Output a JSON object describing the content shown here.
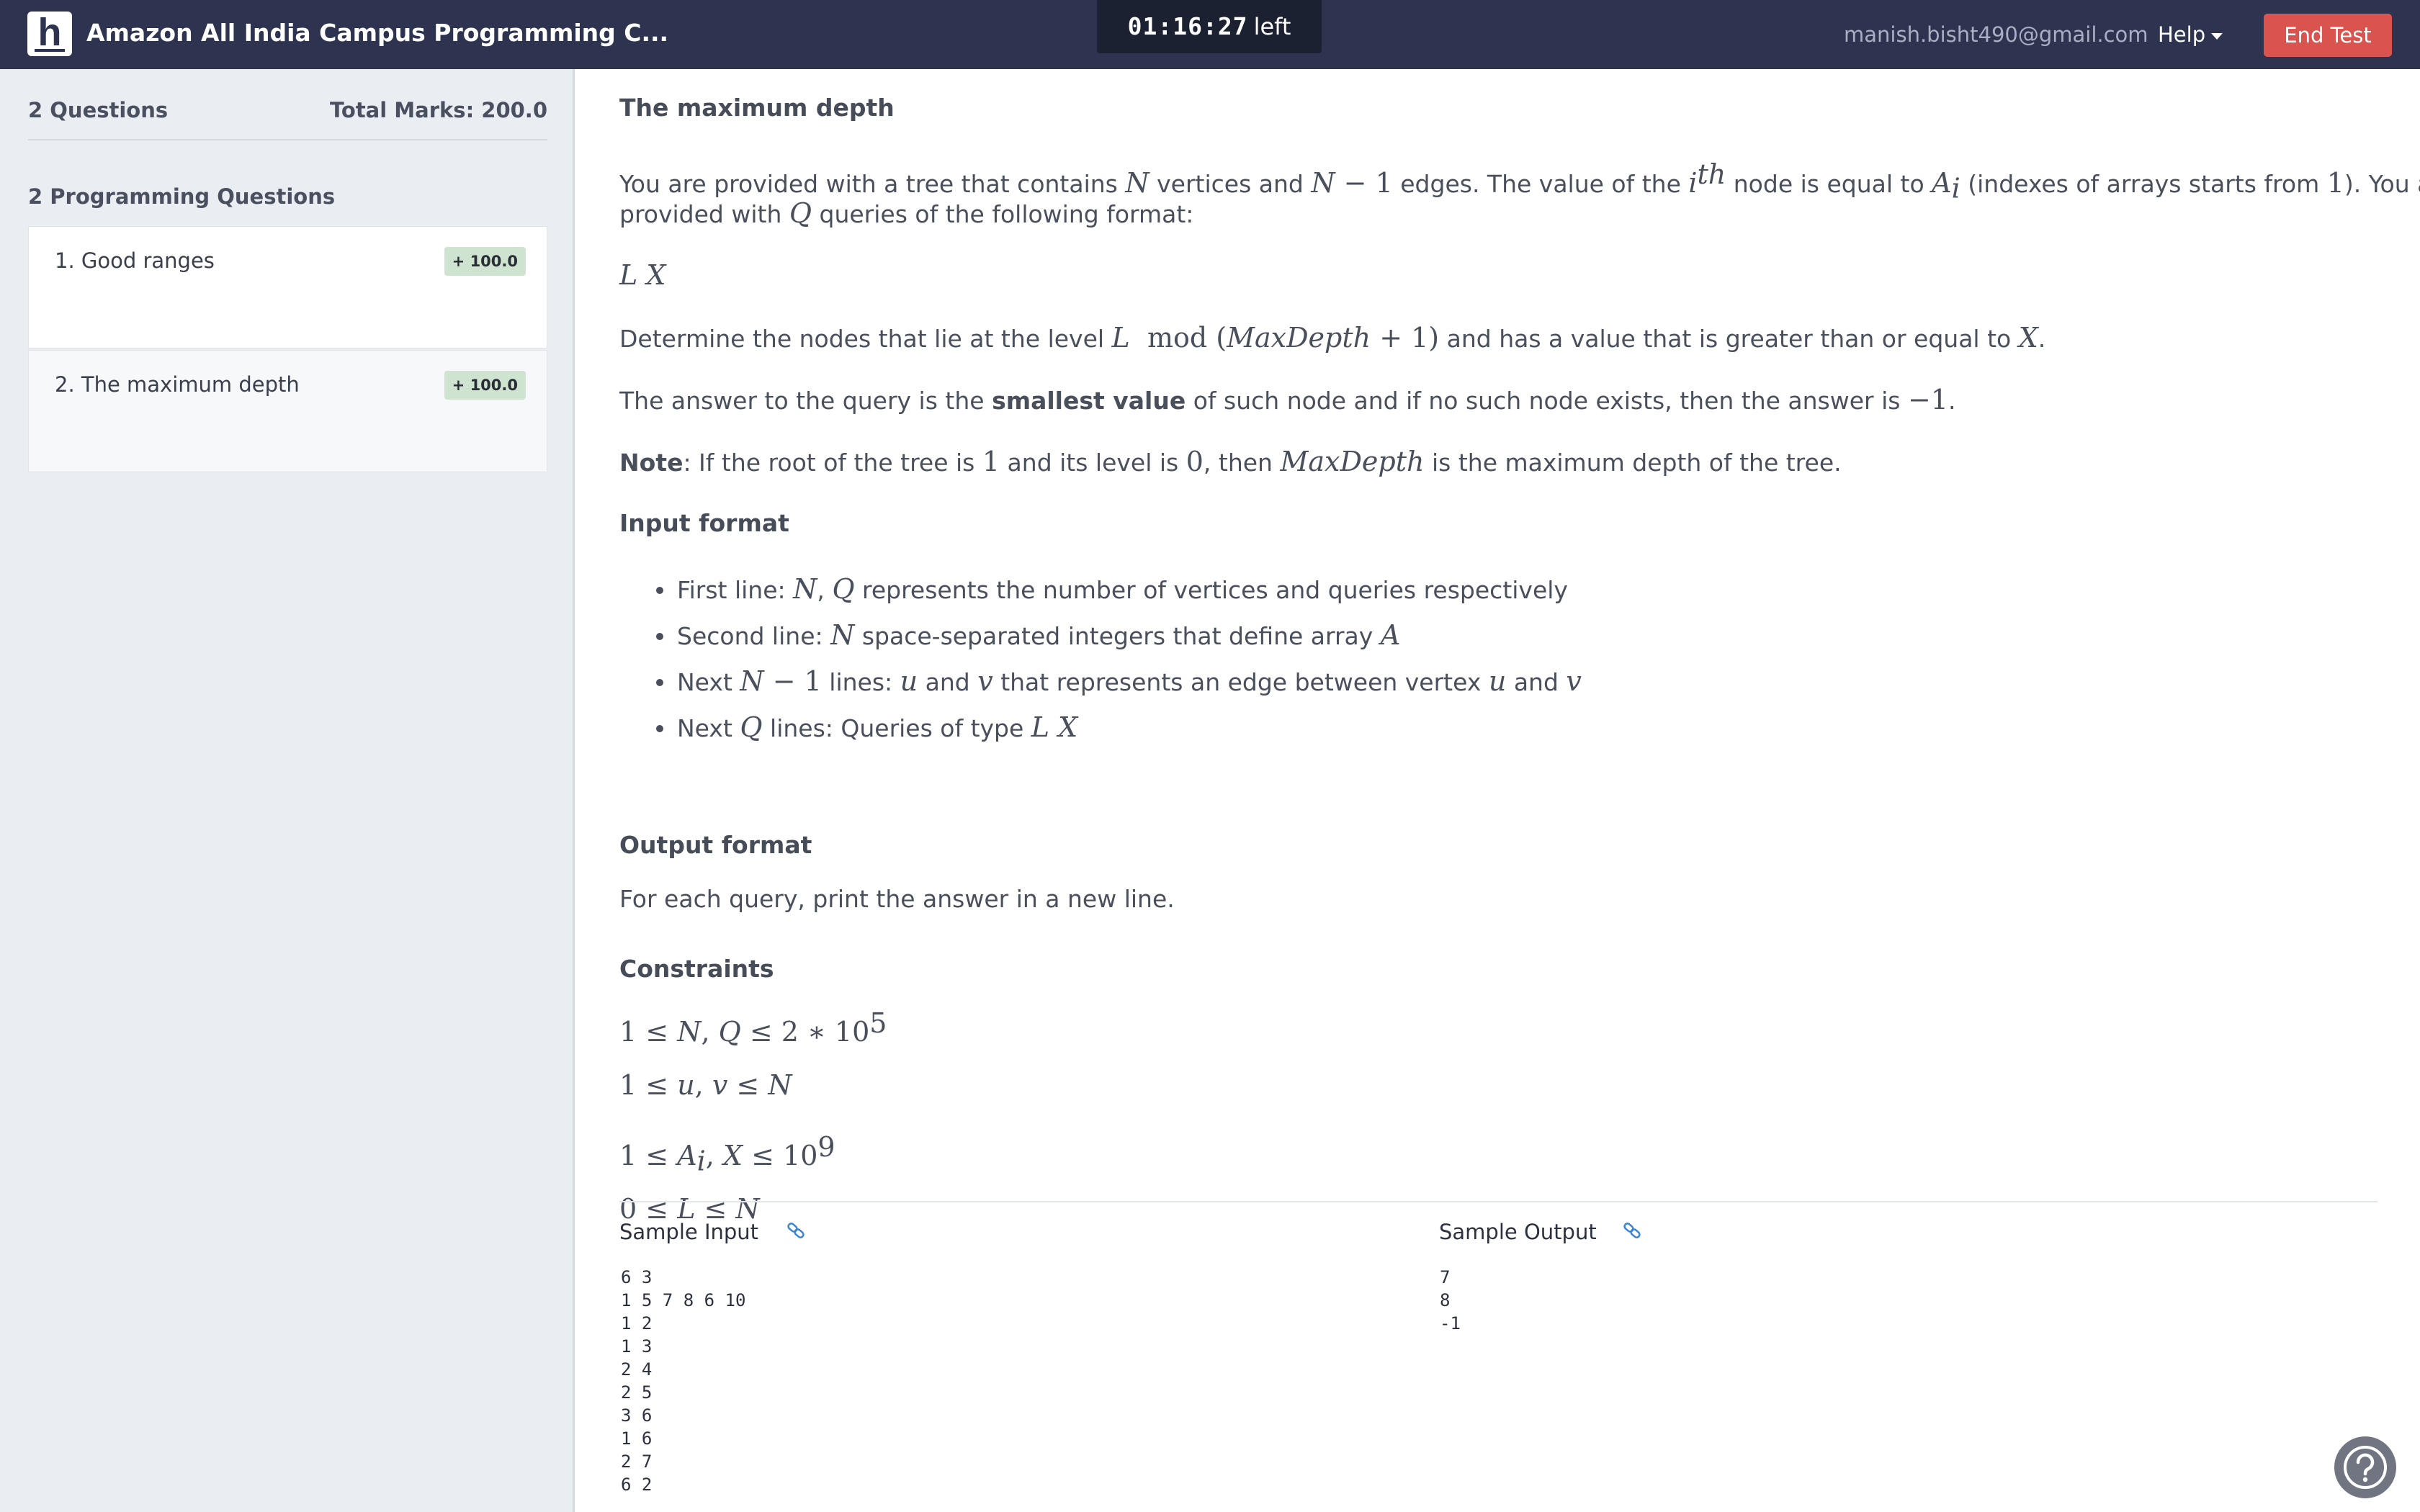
{
  "header": {
    "logo_letter": "h",
    "title": "Amazon All India Campus Programming C...",
    "timer_value": "01:16:27",
    "timer_suffix": "left",
    "user_email": "manish.bisht490@gmail.com",
    "help_label": "Help",
    "end_test_label": "End Test"
  },
  "sidebar": {
    "question_count": "2 Questions",
    "total_marks": "Total Marks: 200.0",
    "section_title": "2 Programming Questions",
    "questions": [
      {
        "title": "1. Good ranges",
        "marks": "+ 100.0"
      },
      {
        "title": "2. The maximum depth",
        "marks": "+ 100.0"
      }
    ]
  },
  "problem": {
    "title": "The maximum depth",
    "statement": {
      "line1_t1": "You are provided with a tree that contains ",
      "line1_m1": "N",
      "line1_t2": " vertices and ",
      "line1_m2": "N",
      "line1_m2b": " − 1",
      "line1_t3": " edges. The value of the ",
      "line1_m3": "i",
      "line1_m3sup": "th",
      "line1_t4": " node is equal to ",
      "line1_m4": "A",
      "line1_m4sub": "i",
      "line1_t5": " (indexes of arrays starts from ",
      "line1_m5": "1",
      "line1_t6": "). You are also",
      "line2_t1": "provided with ",
      "line2_m1": "Q",
      "line2_t2": " queries of the following format:"
    },
    "query_format": "L X",
    "determine": {
      "t1": "Determine the nodes that lie at the level ",
      "m1": "L",
      "m2": "  mod ",
      "m3": "(",
      "m4": "MaxDepth",
      "m5": " + 1)",
      "t2": " and has a value that is greater than or equal to ",
      "m6": "X",
      "t3": "."
    },
    "answer": {
      "t1": "The answer to the query is the ",
      "bold": "smallest value",
      "t2": " of such node and if no such node exists, then the answer is ",
      "m1": "−1",
      "t3": "."
    },
    "note": {
      "label": "Note",
      "t1": ": If the root of the tree is ",
      "m1": "1",
      "t2": " and its level is ",
      "m2": "0",
      "t3": ", then ",
      "m3": "MaxDepth",
      "t4": " is the maximum depth of the tree."
    },
    "input_format_title": "Input format",
    "input_items": [
      {
        "t1": "First line: ",
        "m1": "N",
        "t2": ", ",
        "m2": "Q",
        "t3": " represents the number of vertices and queries respectively"
      },
      {
        "t1": "Second line: ",
        "m1": "N",
        "t2": " space-separated integers that define array ",
        "m2": "A",
        "t3": ""
      },
      {
        "t1": "Next ",
        "m1": "N",
        "m1b": " − 1",
        "t2": " lines: ",
        "m2": "u",
        "t3": " and ",
        "m3": "v",
        "t4": " that represents an edge between vertex ",
        "m4": "u",
        "t5": " and ",
        "m5": "v"
      },
      {
        "t1": "Next ",
        "m1": "Q",
        "t2": " lines: Queries of type ",
        "m2": "L X"
      }
    ],
    "output_format_title": "Output format",
    "output_text": "For each query, print the answer in a new line.",
    "constraints_title": "Constraints",
    "constraints": {
      "c1_a": "1 ≤ ",
      "c1_b": "N",
      "c1_c": ", ",
      "c1_d": "Q",
      "c1_e": " ≤ 2 ∗ 10",
      "c1_sup": "5",
      "c2_a": "1 ≤ ",
      "c2_b": "u",
      "c2_c": ", ",
      "c2_d": "v",
      "c2_e": " ≤ ",
      "c2_f": "N",
      "c3_a": "1 ≤ ",
      "c3_b": "A",
      "c3_sub": "i",
      "c3_c": ", ",
      "c3_d": "X",
      "c3_e": " ≤ 10",
      "c3_sup": "9",
      "c4_a": "0 ≤ ",
      "c4_b": "L",
      "c4_c": " ≤ ",
      "c4_d": "N"
    },
    "sample_input_label": "Sample Input",
    "sample_output_label": "Sample Output",
    "sample_input": "6 3\n1 5 7 8 6 10\n1 2\n1 3\n2 4\n2 5\n3 6\n1 6\n2 7\n6 2",
    "sample_output": "7\n8\n-1"
  },
  "colors": {
    "header_bg": "#2e3450",
    "end_test_bg": "#d9534f",
    "sidebar_bg": "#eaedf2",
    "badge_bg": "#cfe3d1",
    "link_icon": "#3a84d6"
  },
  "icons": [
    "logo-icon",
    "caret-down-icon",
    "link-icon",
    "help-circle-icon"
  ]
}
